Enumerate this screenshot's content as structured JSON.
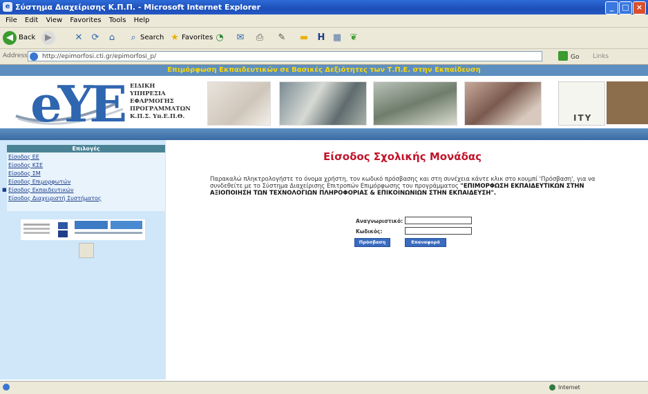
{
  "window": {
    "title": "Σύστημα Διαχείρισης Κ.Π.Π. - Microsoft Internet Explorer",
    "controls": [
      "_",
      "□",
      "×"
    ]
  },
  "menu": [
    "File",
    "Edit",
    "View",
    "Favorites",
    "Tools",
    "Help"
  ],
  "toolbar": {
    "back_label": "Back",
    "search_label": "Search",
    "favorites_label": "Favorites"
  },
  "address": {
    "label": "Address",
    "url": "http://epimorfosi.cti.gr/epimorfosi_p/",
    "go_label": "Go",
    "links_label": "Links"
  },
  "page": {
    "header_bar": "Επιμόρφωση Εκπαιδευτικών σε Βασικές Δεξιότητες των Τ.Π.Ε. στην Εκπαίδευση",
    "logo_text": "eYE",
    "org_lines": [
      "ΕΙΔΙΚΗ",
      "ΥΠΗΡΕΣΙΑ",
      "ΕΦΑΡΜΟΓΗΣ",
      "ΠΡΟΓΡΑΜΜΑΤΩΝ",
      "Κ.Π.Σ. Υπ.Ε.Π.Θ."
    ],
    "ity_text": "ITY"
  },
  "sidebar": {
    "heading": "Επιλογές",
    "items": [
      {
        "label": "Είσοδος ΕΕ"
      },
      {
        "label": "Είσοδος ΚΣΕ"
      },
      {
        "label": "Είσοδος ΣΜ"
      },
      {
        "label": "Είσοδος Επιμορφωτών"
      },
      {
        "label": "Είσοδος Εκπαιδευτικών"
      },
      {
        "label": "Είσοδος Διαχειριστή Συστήματος"
      }
    ]
  },
  "main": {
    "title": "Είσοδος Σχολικής Μονάδας",
    "intro_plain": "Παρακαλώ πληκτρολογήστε το όνομα χρήστη, τον κωδικό πρόσβασης και στη συνέχεια κάντε κλικ στο κουμπί 'Πρόσβαση', για να συνδεθείτε με το Σύστημα Διαχείρισης Επιτροπών Επιμόρφωσης του προγράμματος",
    "intro_bold": "\"ΕΠΙΜΟΡΦΩΣΗ ΕΚΠΑΙΔΕΥΤΙΚΩΝ ΣΤΗΝ ΑΞΙΟΠΟΙΗΣΗ ΤΩΝ ΤΕΧΝΟΛΟΓΙΩΝ ΠΛΗΡΟΦΟΡΙΑΣ & ΕΠΙΚΟΙΝΩΝΙΩΝ ΣΤΗΝ ΕΚΠΑΙΔΕΥΣΗ\".",
    "username_label": "Αναγνωριστικό:",
    "password_label": "Κωδικός:",
    "username_value": "",
    "password_value": "",
    "submit_label": "Πρόσβαση",
    "clear_label": "Επαναφορά"
  },
  "status": {
    "zone": "Internet"
  },
  "colors": {
    "title_red": "#c0132a",
    "sidebar_bg": "#cfe7f8",
    "header_bar": "#5c8fbf",
    "header_text": "#ffd800",
    "button_blue": "#3a6bbf"
  }
}
